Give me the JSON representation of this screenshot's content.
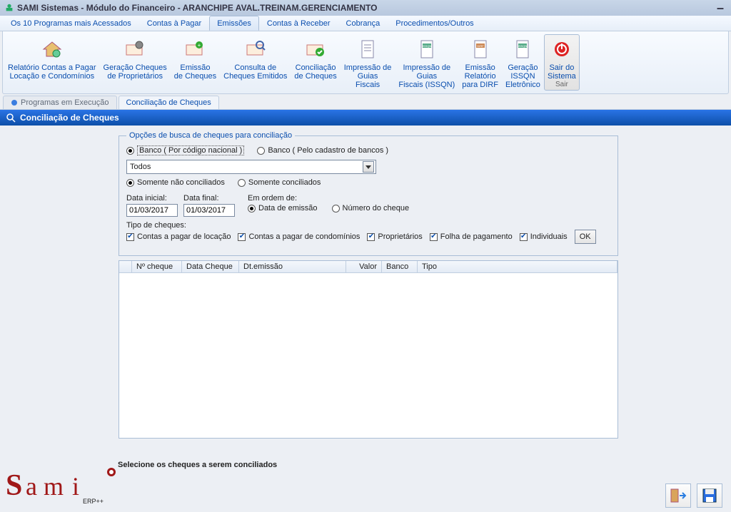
{
  "titlebar": {
    "text": "SAMI Sistemas - Módulo do Financeiro - ARANCHIPE AVAL.TREINAM.GERENCIAMENTO"
  },
  "menu": {
    "programas": "Os 10 Programas mais Acessados",
    "contas_pagar": "Contas à Pagar",
    "emissoes": "Emissões",
    "contas_receber": "Contas à Receber",
    "cobranca": "Cobrança",
    "procedimentos": "Procedimentos/Outros"
  },
  "ribbon": {
    "r1a": "Relatório Contas a Pagar",
    "r1b": "Locação e Condomínios",
    "r2a": "Geração Cheques",
    "r2b": "de Proprietários",
    "r3a": "Emissão",
    "r3b": "de Cheques",
    "r4a": "Consulta de",
    "r4b": "Cheques Emitidos",
    "r5a": "Conciliação",
    "r5b": "de Cheques",
    "r6a": "Impressão de",
    "r6b": "Guias",
    "r6c": "Fiscais",
    "r7a": "Impressão de",
    "r7b": "Guias",
    "r7c": "Fiscais (ISSQN)",
    "r8a": "Emissão",
    "r8b": "Relatório",
    "r8c": "para DIRF",
    "r9a": "Geração",
    "r9b": "ISSQN",
    "r9c": "Eletrônico",
    "rsaira": "Sair do",
    "rsairb": "Sistema",
    "rsairc": "Sair"
  },
  "subtabs": {
    "prog": "Programas em Execução",
    "conc": "Conciliação de Cheques"
  },
  "panebar": "Conciliação de Cheques",
  "opts": {
    "legend": "Opções de busca de cheques para conciliação",
    "banco_nac": "Banco ( Por código nacional )",
    "banco_cad": "Banco ( Pelo cadastro de bancos )",
    "select_val": "Todos",
    "nao_conc": "Somente não conciliados",
    "conc": "Somente conciliados",
    "data_ini_lbl": "Data inicial:",
    "data_fin_lbl": "Data final:",
    "data_ini": "01/03/2017",
    "data_fin": "01/03/2017",
    "ordem_lbl": "Em ordem de:",
    "ordem_emissao": "Data de emissão",
    "ordem_numero": "Número do cheque",
    "tipo_lbl": "Tipo de cheques:",
    "cb1": "Contas a pagar de locação",
    "cb2": "Contas a pagar de condomínios",
    "cb3": "Proprietários",
    "cb4": "Folha de pagamento",
    "cb5": "Individuais",
    "ok": "OK"
  },
  "grid": {
    "h1": "Nº cheque",
    "h2": "Data Cheque",
    "h3": "Dt.emissão",
    "h4": "Valor",
    "h5": "Banco",
    "h6": "Tipo"
  },
  "instruction": "Selecione os cheques a serem conciliados",
  "logo": {
    "erp": "ERP++"
  }
}
